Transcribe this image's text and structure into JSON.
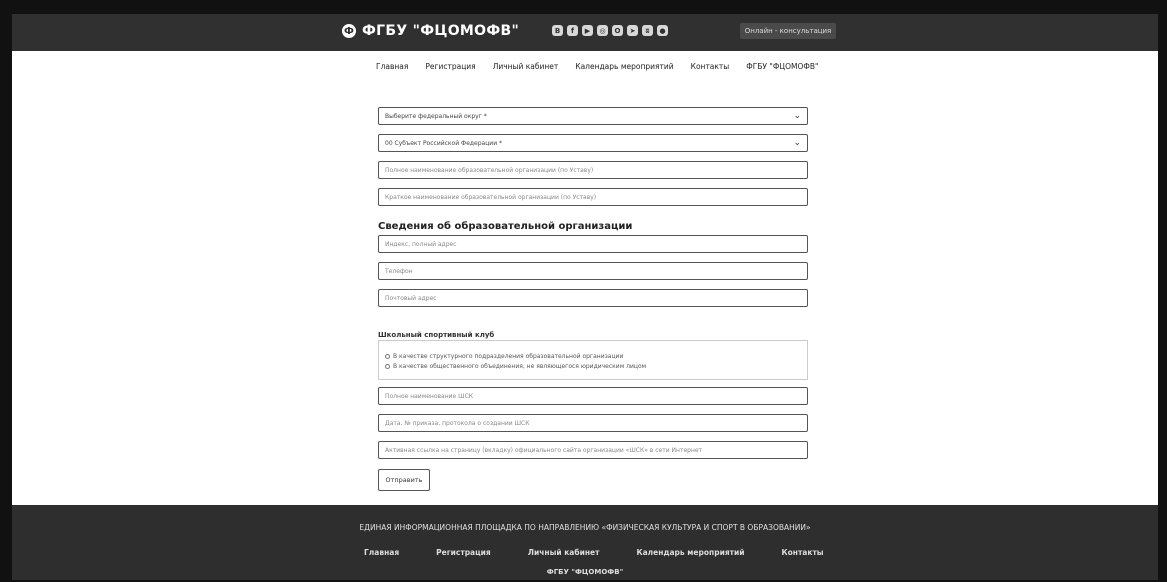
{
  "header": {
    "logo_mark": "Ф",
    "logo_text": "ФГБУ \"ФЦОМОФВ\"",
    "socials": [
      {
        "icon": "vk-icon",
        "glyph": "В"
      },
      {
        "icon": "facebook-icon",
        "glyph": "f"
      },
      {
        "icon": "youtube-icon",
        "glyph": "▶"
      },
      {
        "icon": "instagram-icon",
        "glyph": "◎"
      },
      {
        "icon": "odnoklassniki-icon",
        "glyph": "О"
      },
      {
        "icon": "telegram-icon",
        "glyph": "➤"
      },
      {
        "icon": "vkontakte-icon",
        "glyph": "ʬ"
      },
      {
        "icon": "ok-icon",
        "glyph": "●"
      }
    ],
    "consult_button": "Онлайн - консультация"
  },
  "nav": {
    "items": [
      "Главная",
      "Регистрация",
      "Личный кабинет",
      "Календарь мероприятий",
      "Контакты",
      "ФГБУ \"ФЦОМОФВ\""
    ]
  },
  "form": {
    "federal_district": "Выберите федеральный округ *",
    "subject": "00 Субъект Российской Федерации *",
    "full_name_placeholder": "Полное наименование образовательной организации (по Уставу)",
    "short_name_placeholder": "Краткое наименование образовательной организации (по Уставу)",
    "section_title": "Сведения об образовательной организации",
    "address_placeholder": "Индекс, полный адрес",
    "phone_placeholder": "Телефон",
    "email_placeholder": "Почтовый адрес",
    "club_title": "Школьный спортивный клуб",
    "club_options": [
      "В качестве структурного подразделения образовательной организации",
      "В качестве общественного объединения, не являющегося юридическим лицом"
    ],
    "club_name_placeholder": "Полное наименование ШСК",
    "order_placeholder": "Дата, № приказа, протокола о создании ШСК",
    "link_placeholder": "Активная ссылка на страницу (вкладку) официального сайта организации «ШСК» в сети Интернет",
    "submit_label": "Отправить"
  },
  "footer": {
    "tagline": "ЕДИНАЯ ИНФОРМАЦИОННАЯ ПЛОЩАДКА ПО НАПРАВЛЕНИЮ «ФИЗИЧЕСКАЯ КУЛЬТУРА И СПОРТ В ОБРАЗОВАНИИ»",
    "nav": [
      "Главная",
      "Регистрация",
      "Личный кабинет",
      "Календарь мероприятий",
      "Контакты"
    ],
    "org": "ФГБУ \"ФЦОМОФВ\""
  },
  "colors": {
    "header_bg": "#303030",
    "footer_bg": "#2e2e2e",
    "page_bg": "#ffffff"
  }
}
